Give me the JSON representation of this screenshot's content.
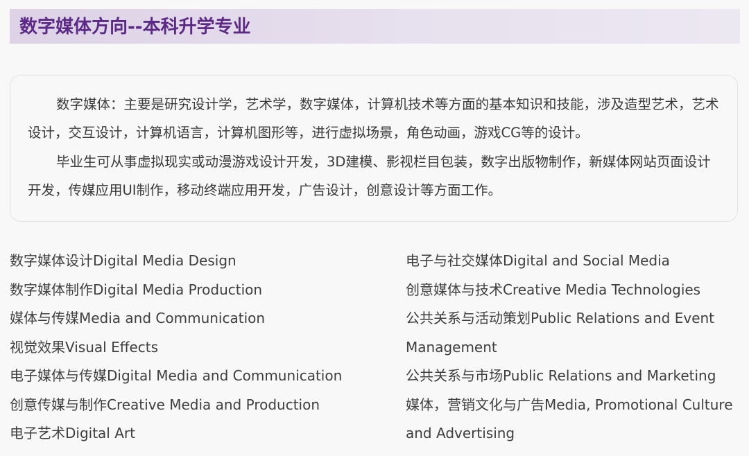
{
  "header": {
    "title": "数字媒体方向--本科升学专业"
  },
  "intro": {
    "paragraph_1": "数字媒体：主要是研究设计学，艺术学，数字媒体，计算机技术等方面的基本知识和技能，涉及造型艺术，艺术设计，交互设计，计算机语言，计算机图形等，进行虚拟场景，角色动画，游戏CG等的设计。",
    "paragraph_2": "毕业生可从事虚拟现实或动漫游戏设计开发，3D建模、影视栏目包装，数字出版物制作，新媒体网站页面设计开发，传媒应用UI制作，移动终端应用开发，广告设计，创意设计等方面工作。"
  },
  "majors": {
    "left": [
      "数字媒体设计Digital Media Design",
      "数字媒体制作Digital Media Production",
      "媒体与传媒Media and Communication",
      "视觉效果Visual Effects",
      "电子媒体与传媒Digital Media and Communication",
      "创意传媒与制作Creative Media and Production",
      "电子艺术Digital Art"
    ],
    "right": [
      "电子与社交媒体Digital and Social Media",
      "创意媒体与技术Creative Media Technologies",
      "公共关系与活动策划Public Relations and Event Management",
      "公共关系与市场Public Relations and Marketing",
      "媒体，营销文化与广告Media, Promotional Culture and Advertising"
    ]
  }
}
